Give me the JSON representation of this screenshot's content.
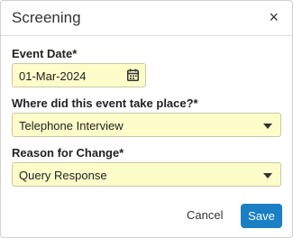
{
  "dialog": {
    "title": "Screening",
    "close_glyph": "×"
  },
  "fields": {
    "event_date": {
      "label": "Event Date*",
      "value": "01-Mar-2024"
    },
    "event_location": {
      "label": "Where did this event take place?*",
      "value": "Telephone Interview"
    },
    "reason": {
      "label": "Reason for Change*",
      "value": "Query Response"
    }
  },
  "actions": {
    "cancel": "Cancel",
    "save": "Save"
  },
  "colors": {
    "field_bg": "#fdfdc9",
    "primary": "#1a7fc4"
  },
  "icons": {
    "date": "calendar-icon",
    "dropdown": "chevron-down-icon",
    "close": "close-icon"
  }
}
